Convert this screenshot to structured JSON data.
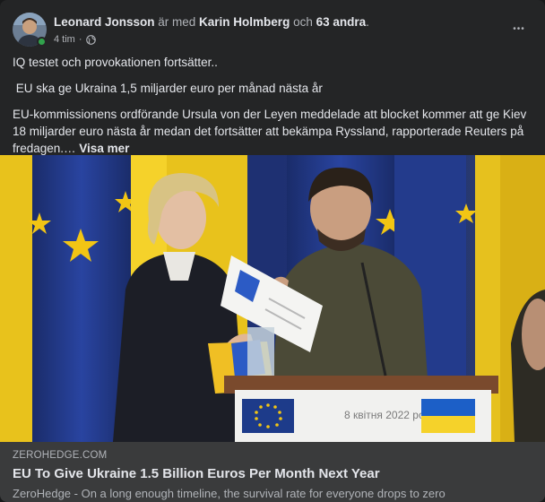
{
  "post": {
    "author": "Leonard Jonsson",
    "with_text": " är med ",
    "tagged": "Karin Holmberg",
    "and_text": " och ",
    "others": "63 andra",
    "period": ".",
    "time": "4 tim",
    "separator": "·",
    "audience_icon": "globe-icon",
    "more_icon": "ellipsis-icon",
    "more_label": "•••",
    "paragraphs": [
      "IQ testet och provokationen fortsätter..",
      " EU ska ge Ukraina 1,5 miljarder euro per månad nästa år"
    ],
    "body": "EU-kommissionens ordförande Ursula von der Leyen meddelade att blocket kommer att ge Kiev 18 miljarder euro nästa år medan det fortsätter att bekämpa Ryssland,  rapporterade Reuters   på fredagen.… ",
    "see_more": "Visa mer"
  },
  "photo": {
    "sign_text": "8 квітня 2022 року"
  },
  "link": {
    "domain": "ZEROHEDGE.COM",
    "title": "EU To Give Ukraine 1.5 Billion Euros Per Month Next Year",
    "description": "ZeroHedge - On a long enough timeline, the survival rate for everyone drops to zero"
  },
  "colors": {
    "card_bg": "#242526",
    "link_bg": "#3a3b3c",
    "primary_text": "#e4e6eb",
    "secondary_text": "#b0b3b8",
    "online": "#31a24c",
    "eu_blue": "#1d3b8a",
    "eu_yellow": "#f2c514",
    "ua_blue": "#1c5fc7",
    "ua_yellow": "#f5d22a"
  }
}
